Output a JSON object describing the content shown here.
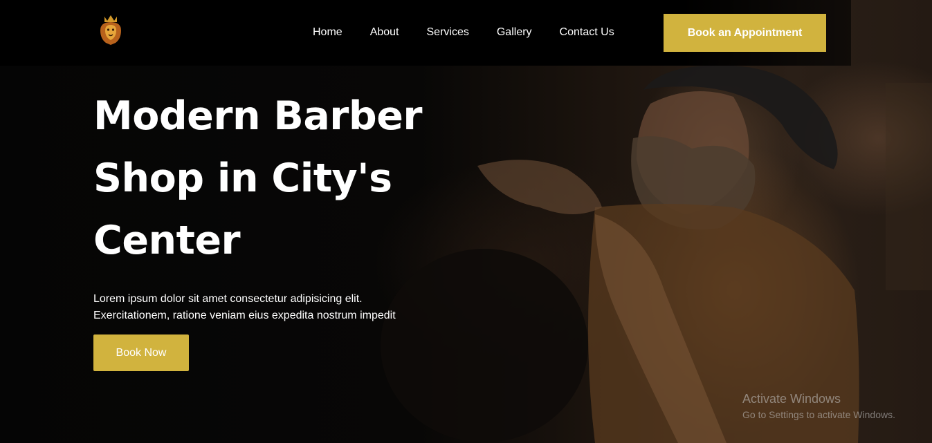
{
  "nav": {
    "items": [
      {
        "label": "Home"
      },
      {
        "label": "About"
      },
      {
        "label": "Services"
      },
      {
        "label": "Gallery"
      },
      {
        "label": "Contact Us"
      }
    ],
    "cta_label": "Book an Appointment"
  },
  "hero": {
    "title_lines": [
      "Modern Barber",
      "Shop in City's",
      "Center"
    ],
    "description_lines": [
      "Lorem ipsum dolor sit amet consectetur adipisicing elit.",
      "Exercitationem, ratione veniam eius expedita nostrum impedit"
    ],
    "button_label": "Book Now"
  },
  "watermark": {
    "title": "Activate Windows",
    "subtitle": "Go to Settings to activate Windows."
  },
  "colors": {
    "accent": "#d1b33e",
    "background": "#000000",
    "text": "#ffffff"
  },
  "icons": {
    "logo": "lion-crown-logo-icon"
  }
}
